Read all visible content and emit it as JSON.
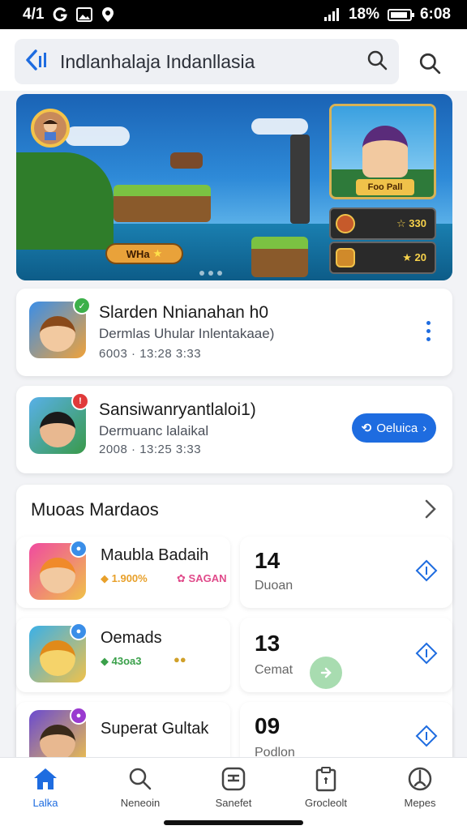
{
  "status_bar": {
    "left_text": "4/1",
    "time": "6:08",
    "battery": "18%"
  },
  "search": {
    "value": "Indlanhalaja Indanllasia"
  },
  "banner": {
    "pill_text": "WHa",
    "side_tag": "Foo Pall",
    "bar1_text": "☆ 330",
    "bar2_text": "★ 20"
  },
  "apps": [
    {
      "title": "Slarden Nnianahan h0",
      "subtitle": "Dermlas Uhular Inlentakaae)",
      "meta": "6003 · 13:28 3:33"
    },
    {
      "title": "Sansiwanryantlaloi1)",
      "subtitle": "Dermuanc lalaikal",
      "meta": "2008 · 13:25 3:33",
      "button_label": "Oeluica"
    }
  ],
  "section": {
    "title": "Muoas Mardaos",
    "items": [
      {
        "name": "Maubla Badaih",
        "tag1": "1.900%",
        "tag2": "SAGAN",
        "count": "14",
        "count_label": "Duoan"
      },
      {
        "name": "Oemads",
        "tag1": "43oa3",
        "tag2": "",
        "count": "13",
        "count_label": "Cemat"
      },
      {
        "name": "Superat Gultak",
        "tag1": "",
        "tag2": "",
        "count": "09",
        "count_label": "Podlon"
      }
    ]
  },
  "nav": [
    {
      "label": "Lalka",
      "icon": "home-icon"
    },
    {
      "label": "Neneoin",
      "icon": "search-icon"
    },
    {
      "label": "Sanefet",
      "icon": "chat-icon"
    },
    {
      "label": "Grocleolt",
      "icon": "clipboard-icon"
    },
    {
      "label": "Mepes",
      "icon": "profile-icon"
    }
  ],
  "colors": {
    "accent": "#1e6ce0",
    "background": "#f2f3f6"
  }
}
